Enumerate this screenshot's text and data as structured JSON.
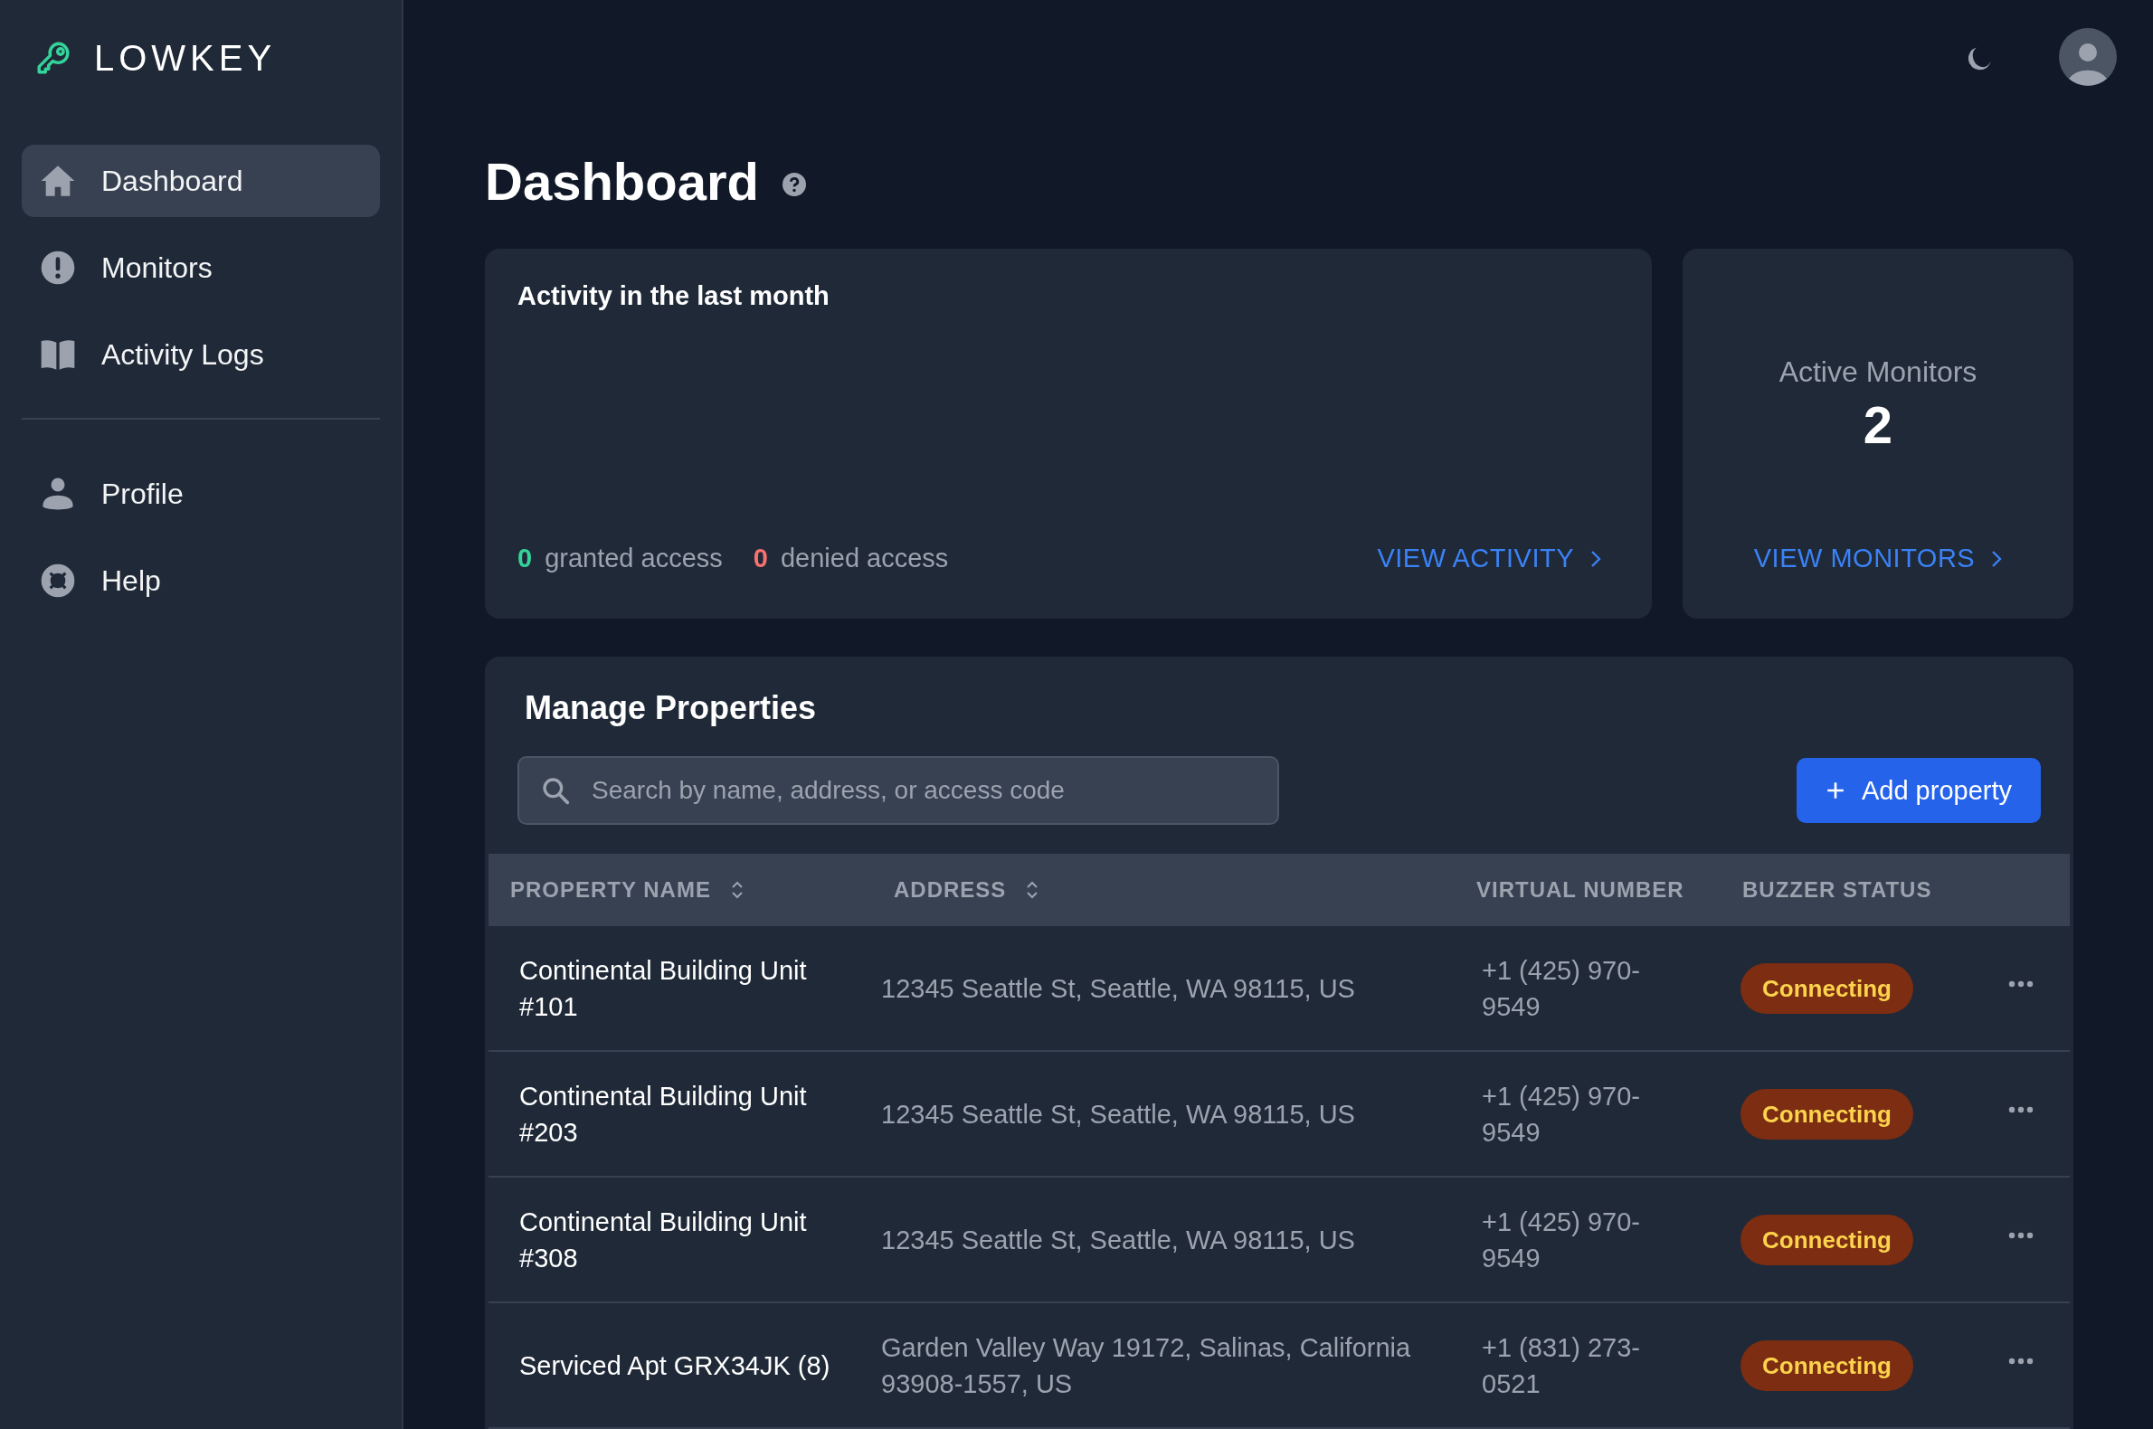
{
  "brand": {
    "name": "LOWKEY"
  },
  "sidebar": {
    "items": [
      {
        "label": "Dashboard",
        "selected": true
      },
      {
        "label": "Monitors",
        "selected": false
      },
      {
        "label": "Activity Logs",
        "selected": false
      }
    ],
    "bottom_items": [
      {
        "label": "Profile",
        "selected": false
      },
      {
        "label": "Help",
        "selected": false
      }
    ]
  },
  "page": {
    "title": "Dashboard"
  },
  "activity_card": {
    "title": "Activity in the last month",
    "granted_count": "0",
    "granted_label": "granted access",
    "denied_count": "0",
    "denied_label": "denied access",
    "link": "VIEW ACTIVITY"
  },
  "monitors_card": {
    "label": "Active Monitors",
    "value": "2",
    "link": "VIEW MONITORS"
  },
  "properties": {
    "title": "Manage Properties",
    "search": {
      "placeholder": "Search by name, address, or access code"
    },
    "add_button": "Add property",
    "columns": [
      {
        "label": "PROPERTY NAME",
        "sortable": true
      },
      {
        "label": "ADDRESS",
        "sortable": true
      },
      {
        "label": "VIRTUAL NUMBER",
        "sortable": false
      },
      {
        "label": "BUZZER STATUS",
        "sortable": false
      }
    ],
    "rows": [
      {
        "name": "Continental Building Unit #101",
        "address": "12345 Seattle St, Seattle, WA 98115, US",
        "number": "+1 (425) 970-9549",
        "status": "Connecting"
      },
      {
        "name": "Continental Building Unit #203",
        "address": "12345 Seattle St, Seattle, WA 98115, US",
        "number": "+1 (425) 970-9549",
        "status": "Connecting"
      },
      {
        "name": "Continental Building Unit #308",
        "address": "12345 Seattle St, Seattle, WA 98115, US",
        "number": "+1 (425) 970-9549",
        "status": "Connecting"
      },
      {
        "name": "Serviced Apt GRX34JK (8)",
        "address": "Garden Valley Way 19172, Salinas, California 93908-1557, US",
        "number": "+1 (831) 273-0521",
        "status": "Connecting"
      }
    ]
  }
}
